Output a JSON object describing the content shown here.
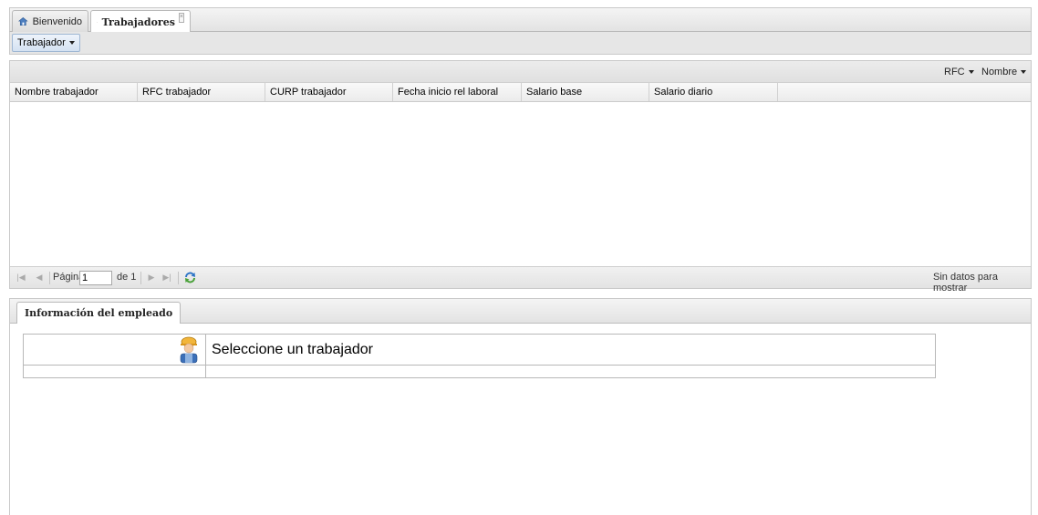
{
  "tabs": [
    {
      "label": "Bienvenido",
      "icon": "home-icon"
    },
    {
      "label": "Trabajadores",
      "icon": "worker-icon",
      "closable": true
    }
  ],
  "toolbar": {
    "menu_label": "Trabajador"
  },
  "grid": {
    "sort_buttons": [
      "RFC",
      "Nombre"
    ],
    "columns": [
      "Nombre trabajador",
      "RFC trabajador",
      "CURP trabajador",
      "Fecha inicio rel laboral",
      "Salario base",
      "Salario diario"
    ],
    "rows": []
  },
  "pager": {
    "page_label": "Página",
    "page_value": "1",
    "of_label": "de 1",
    "empty_message": "Sin datos para mostrar"
  },
  "info": {
    "tab_label": "Información del empleado",
    "select_message": "Seleccione un trabajador"
  },
  "colors": {
    "menu_button": "#d4e2f2",
    "panel_header": "#e6e6e6",
    "border": "#c9c9c9"
  }
}
